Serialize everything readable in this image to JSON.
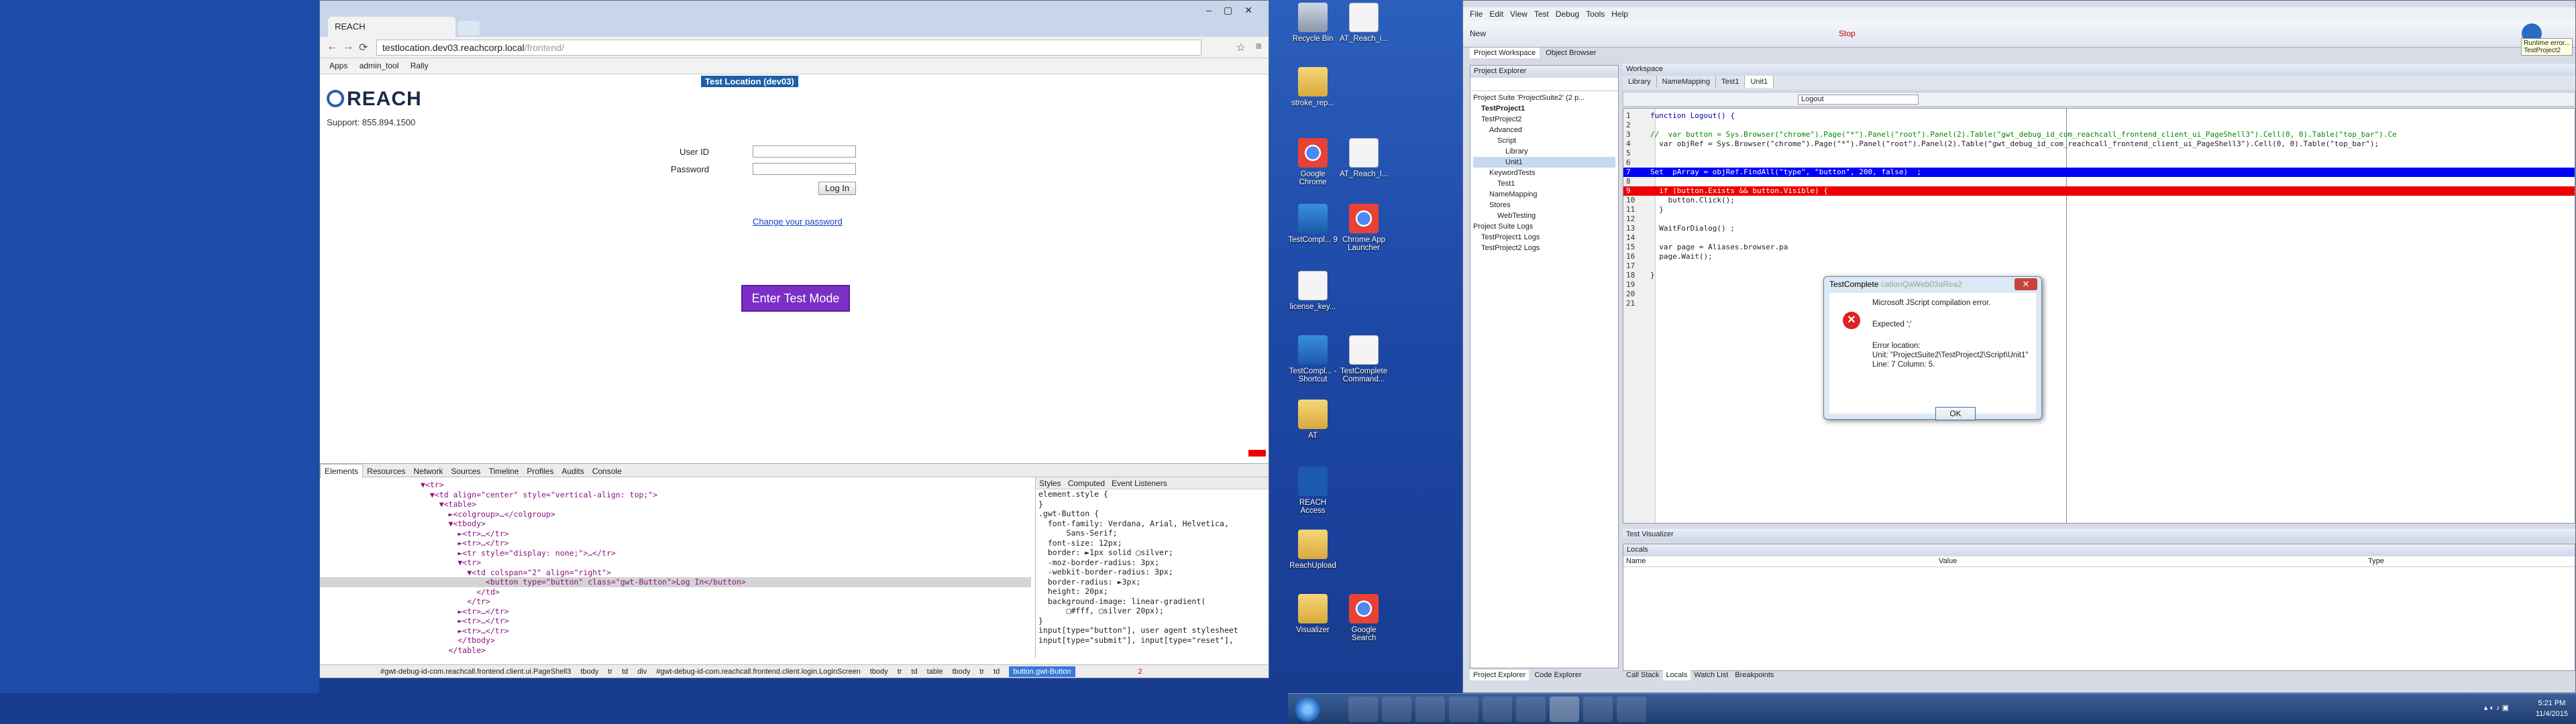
{
  "chrome": {
    "tab_title": "REACH",
    "url_main": "testlocation.dev03.reachcorp.local",
    "url_path": "/frontend/",
    "bookmarks": [
      "Apps",
      "admin_tool",
      "Rally"
    ]
  },
  "page": {
    "logo_text": "REACH",
    "support": "Support: 855.894.1500",
    "test_location": "Test Location (dev03)",
    "user_id_label": "User ID",
    "password_label": "Password",
    "login_label": "Log In",
    "change_password": "Change your password",
    "enter_test_mode": "Enter Test Mode"
  },
  "devtools": {
    "tabs": [
      "Elements",
      "Resources",
      "Network",
      "Sources",
      "Timeline",
      "Profiles",
      "Audits",
      "Console"
    ],
    "dom_lines": [
      "▼<tr>",
      "  ▼<td align=\"center\" style=\"vertical-align: top;\">",
      "    ▼<table>",
      "      ►<colgroup>…</colgroup>",
      "      ▼<tbody>",
      "        ►<tr>…</tr>",
      "        ►<tr>…</tr>",
      "        ►<tr style=\"display: none;\">…</tr>",
      "        ▼<tr>",
      "          ▼<td colspan=\"2\" align=\"right\">",
      "              <button type=\"button\" class=\"gwt-Button\">Log In</button>",
      "            </td>",
      "          </tr>",
      "        ►<tr>…</tr>",
      "        ►<tr>…</tr>",
      "        ►<tr>…</tr>",
      "        </tbody>",
      "      </table>"
    ],
    "style_tabs": [
      "Styles",
      "Computed",
      "Event Listeners"
    ],
    "style_lines": [
      "element.style {",
      "}",
      ".gwt-Button {",
      "  font-family: Verdana, Arial, Helvetica,",
      "      Sans-Serif;",
      "  font-size: 12px;",
      "  border: ►1px solid ▢silver;",
      "  -moz-border-radius: 3px;",
      "  -webkit-border-radius: 3px;",
      "  border-radius: ►3px;",
      "  height: 20px;",
      "  background-image: linear-gradient(",
      "      ▢#fff, ▢silver 20px);",
      "}",
      "input[type=\"button\"], user agent stylesheet",
      "input[type=\"submit\"], input[type=\"reset\"],"
    ],
    "status_crumbs": [
      "#gwt-debug-id-com.reachcall.frontend.client.ui.PageShell3",
      "tbody",
      "tr",
      "td",
      "div",
      "#gwt-debug-id-com.reachcall.frontend.client.login.LoginScreen",
      "tbody",
      "tr",
      "td",
      "table",
      "tbody",
      "tr",
      "td"
    ],
    "status_selected": "button.gwt-Button",
    "error_count": "2"
  },
  "desktop_icons": [
    {
      "label": "Recycle Bin",
      "kind": "bin"
    },
    {
      "label": "AT_Reach_i...",
      "kind": "doc"
    },
    {
      "label": "stroke_rep...",
      "kind": "folder"
    },
    {
      "label": "Google Chrome",
      "kind": "chrome"
    },
    {
      "label": "AT_Reach_l...",
      "kind": "doc"
    },
    {
      "label": "TestCompl... 9",
      "kind": "tc"
    },
    {
      "label": "Chrome App Launcher",
      "kind": "chrome"
    },
    {
      "label": "license_key...",
      "kind": "doc"
    },
    {
      "label": "TestCompl... - Shortcut",
      "kind": "tc"
    },
    {
      "label": "TestComplete Command...",
      "kind": "doc"
    },
    {
      "label": "AT",
      "kind": "folder"
    },
    {
      "label": "REACH Access",
      "kind": "reach"
    },
    {
      "label": "ReachUpload",
      "kind": "folder"
    },
    {
      "label": "Visualizer",
      "kind": "folder"
    },
    {
      "label": "Google Search",
      "kind": "chrome"
    }
  ],
  "testcomplete": {
    "menu": [
      "File",
      "Edit",
      "View",
      "Test",
      "Debug",
      "Tools",
      "Help"
    ],
    "new_label": "New",
    "stop_label": "Stop",
    "panel_tabs": [
      "Project Workspace",
      "Object Browser"
    ],
    "explorer_title": "Project Explorer",
    "tree": [
      "Project Suite 'ProjectSuite2' (2 p...",
      "TestProject1",
      "TestProject2",
      "Advanced",
      "Script",
      "Library",
      "Unit1",
      "KeywordTests",
      "Test1",
      "NameMapping",
      "Stores",
      "WebTesting",
      "Project Suite Logs",
      "TestProject1 Logs",
      "TestProject2 Logs"
    ],
    "workspace_title": "Workspace",
    "editor_tabs": [
      "Library",
      "NameMapping",
      "Test1",
      "Unit1"
    ],
    "routine": "Logout",
    "code": [
      {
        "n": "1",
        "t": "function Logout() {"
      },
      {
        "n": "2",
        "t": ""
      },
      {
        "n": "3",
        "t": "//  var button = Sys.Browser(\"chrome\").Page(\"*\").Panel(\"root\").Panel(2).Table(\"gwt_debug_id_com_reachcall_frontend_client_ui_PageShell3\").Cell(0, 0).Table(\"top_bar\").Ce"
      },
      {
        "n": "4",
        "t": "  var objRef = Sys.Browser(\"chrome\").Page(\"*\").Panel(\"root\").Panel(2).Table(\"gwt_debug_id_com_reachcall_frontend_client_ui_PageShell3\").Cell(0, 0).Table(\"top_bar\");"
      },
      {
        "n": "5",
        "t": ""
      },
      {
        "n": "6",
        "t": ""
      },
      {
        "n": "7",
        "t": "Set  pArray = objRef.FindAll(\"type\", \"button\", 200, false)  ;"
      },
      {
        "n": "8",
        "t": ""
      },
      {
        "n": "9",
        "t": "  if (button.Exists && button.Visible) {"
      },
      {
        "n": "10",
        "t": "    button.Click();"
      },
      {
        "n": "11",
        "t": "  }"
      },
      {
        "n": "12",
        "t": ""
      },
      {
        "n": "13",
        "t": "  WaitForDialog() ;"
      },
      {
        "n": "14",
        "t": ""
      },
      {
        "n": "15",
        "t": "  var page = Aliases.browser.pa"
      },
      {
        "n": "16",
        "t": "  page.Wait();"
      },
      {
        "n": "17",
        "t": ""
      },
      {
        "n": "18",
        "t": "}"
      },
      {
        "n": "19",
        "t": ""
      },
      {
        "n": "20",
        "t": ""
      },
      {
        "n": "21",
        "t": ""
      }
    ],
    "test_visualizer": "Test Visualizer",
    "locals_title": "Locals",
    "locals_cols": [
      "Name",
      "Value",
      "Type"
    ],
    "bottom_tabs": [
      "Call Stack",
      "Locals",
      "Watch List",
      "Breakpoints"
    ],
    "left_bottom_tabs": [
      "Project Explorer",
      "Code Explorer"
    ],
    "runtime_tip": "Runtime error...",
    "runtime_sub": "TestProject2"
  },
  "dialog": {
    "title": "TestComplete",
    "title_faint": "cationQaWeb03aRea2",
    "message": "Microsoft JScript compilation error.",
    "expected": "Expected ';'",
    "loc_label": "Error location:",
    "unit": "Unit: \"ProjectSuite2\\TestProject2\\Script\\Unit1\"",
    "line": "Line: 7 Column: 5.",
    "ok": "OK"
  },
  "taskbar": {
    "time": "5:21 PM",
    "date": "11/4/2015"
  }
}
